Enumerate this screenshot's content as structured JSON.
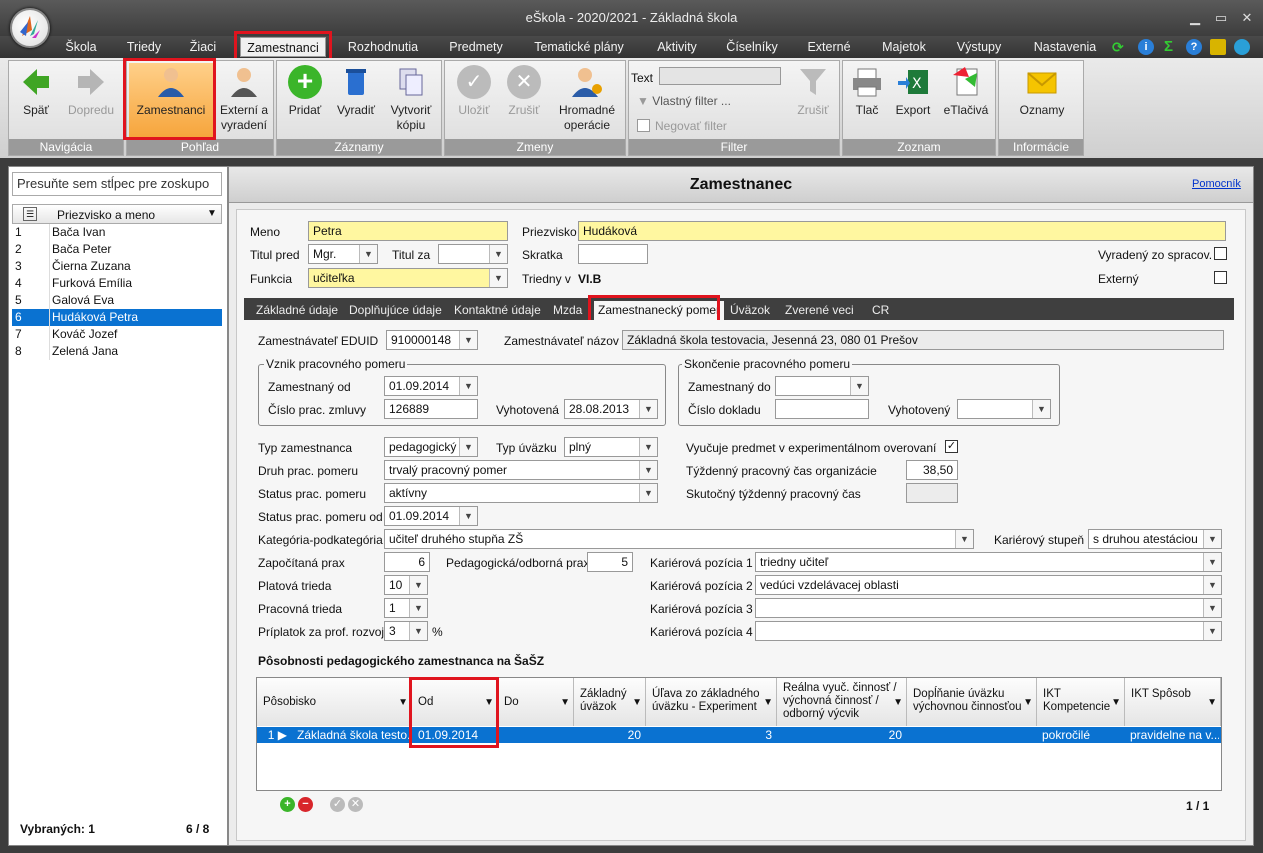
{
  "window": {
    "title": "eŠkola - 2020/2021 - Základná škola"
  },
  "menu": [
    "Škola",
    "Triedy",
    "Žiaci",
    "Zamestnanci",
    "Rozhodnutia",
    "Predmety",
    "Tematické plány",
    "Aktivity",
    "Číselníky",
    "Externé",
    "Majetok",
    "Výstupy",
    "Nastavenia"
  ],
  "ribbon": {
    "navigation": {
      "label": "Navigácia",
      "back": "Späť",
      "forward": "Dopredu"
    },
    "view": {
      "label": "Pohľad",
      "employees": "Zamestnanci",
      "external": "Externí a vyradení"
    },
    "records": {
      "label": "Záznamy",
      "add": "Pridať",
      "remove": "Vyradiť",
      "copy": "Vytvoriť kópiu"
    },
    "changes": {
      "label": "Zmeny",
      "save": "Uložiť",
      "cancel": "Zrušiť",
      "bulk": "Hromadné operácie"
    },
    "filter": {
      "label": "Filter",
      "text": "Text",
      "custom": "Vlastný filter ...",
      "negate": "Negovať filter",
      "clear": "Zrušiť"
    },
    "list": {
      "label": "Zoznam",
      "print": "Tlač",
      "export": "Export",
      "eprint": "eTlačivá"
    },
    "info": {
      "label": "Informácie",
      "notices": "Oznamy"
    }
  },
  "left": {
    "group_hint": "Presuňte sem stĺpec pre zoskupo",
    "column": "Priezvisko a meno",
    "rows": [
      {
        "n": "1",
        "name": "Bača Ivan"
      },
      {
        "n": "2",
        "name": "Bača Peter"
      },
      {
        "n": "3",
        "name": "Čierna Zuzana"
      },
      {
        "n": "4",
        "name": "Furková Emília"
      },
      {
        "n": "5",
        "name": "Galová Eva"
      },
      {
        "n": "6",
        "name": "Hudáková Petra"
      },
      {
        "n": "7",
        "name": "Kováč Jozef"
      },
      {
        "n": "8",
        "name": "Zelená Jana"
      }
    ],
    "selected_label": "Vybraných: 1",
    "count": "6 / 8"
  },
  "main": {
    "title": "Zamestnanec",
    "help": "Pomocník",
    "header": {
      "meno_l": "Meno",
      "meno": "Petra",
      "priezvisko_l": "Priezvisko",
      "priezvisko": "Hudáková",
      "titul_pred_l": "Titul pred",
      "titul_pred": "Mgr.",
      "titul_za_l": "Titul za",
      "titul_za": "",
      "skratka_l": "Skratka",
      "skratka": "",
      "vyradeny_l": "Vyradený zo spracov.",
      "funkcia_l": "Funkcia",
      "funkcia": "učiteľka",
      "triedny_l": "Triedny v",
      "triedny": "VI.B",
      "externy_l": "Externý"
    },
    "tabs": [
      "Základné údaje",
      "Doplňujúce údaje",
      "Kontaktné údaje",
      "Mzda",
      "Zamestnanecký pomer",
      "Úväzok",
      "Zverené veci",
      "CR"
    ],
    "employer": {
      "eduid_l": "Zamestnávateľ EDUID",
      "eduid": "910000148",
      "name_l": "Zamestnávateľ názov",
      "name": "Základná škola testovacia, Jesenná 23, 080 01 Prešov"
    },
    "start": {
      "title": "Vznik pracovného pomeru",
      "from_l": "Zamestnaný od",
      "from": "01.09.2014",
      "contract_l": "Číslo prac. zmluvy",
      "contract": "126889",
      "issued_l": "Vyhotovená",
      "issued": "28.08.2013"
    },
    "end": {
      "title": "Skončenie pracovného pomeru",
      "to_l": "Zamestnaný do",
      "to": "",
      "doc_l": "Číslo dokladu",
      "doc": "",
      "issued_l": "Vyhotovený",
      "issued": ""
    },
    "details": {
      "typ_zam_l": "Typ zamestnanca",
      "typ_zam": "pedagogický",
      "typ_uv_l": "Typ úväzku",
      "typ_uv": "plný",
      "druh_l": "Druh prac. pomeru",
      "druh": "trvalý pracovný pomer",
      "status_l": "Status prac. pomeru",
      "status": "aktívny",
      "status_od_l": "Status prac. pomeru od",
      "status_od": "01.09.2014",
      "exp_l": "Vyučuje predmet v experimentálnom overovaní",
      "tyzd_l": "Týždenný pracovný čas organizácie",
      "tyzd": "38,50",
      "skut_l": "Skutočný týždenný pracovný čas",
      "skut": "",
      "kat_l": "Kategória-podkategória",
      "kat": "učiteľ druhého stupňa ZŠ",
      "kar_st_l": "Kariérový stupeň",
      "kar_st": "s druhou atestáciou",
      "prax_l": "Započítaná prax",
      "prax": "6",
      "ped_prax_l": "Pedagogická/odborná prax",
      "ped_prax": "5",
      "platova_l": "Platová trieda",
      "platova": "10",
      "pracovna_l": "Pracovná trieda",
      "pracovna": "1",
      "priplatok_l": "Príplatok za prof. rozvoj",
      "priplatok": "3",
      "pct": "%",
      "kp1_l": "Kariérová pozícia 1",
      "kp1": "triedny učiteľ",
      "kp2_l": "Kariérová pozícia 2",
      "kp2": "vedúci vzdelávacej oblasti",
      "kp3_l": "Kariérová pozícia 3",
      "kp3": "",
      "kp4_l": "Kariérová pozícia 4",
      "kp4": ""
    },
    "grid": {
      "title": "Pôsobnosti pedagogického zamestnanca na ŠaŠZ",
      "headers": [
        "Pôsobisko",
        "Od",
        "Do",
        "Základný úväzok",
        "Úľava zo základného úväzku - Experiment",
        "Reálna vyuč. činnosť / výchovná činnosť / odborný výcvik",
        "Dopĺňanie úväzku výchovnou činnosťou",
        "IKT Kompetencie",
        "IKT Spôsob"
      ],
      "row": {
        "n": "1",
        "posobisko": "Základná škola testo...",
        "od": "01.09.2014",
        "do": "",
        "zakladny": "20",
        "ulava": "3",
        "realna": "20",
        "doplnanie": "",
        "ikt_k": "pokročilé",
        "ikt_s": "pravidelne na v..."
      },
      "pager": "1 / 1"
    }
  }
}
